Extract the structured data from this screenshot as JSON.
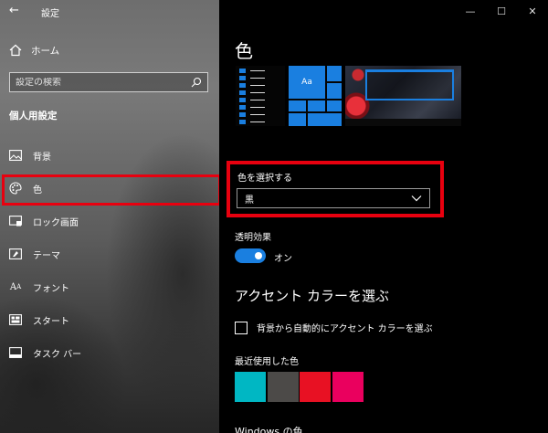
{
  "app": {
    "title": "設定"
  },
  "sidebar": {
    "home_label": "ホーム",
    "search_placeholder": "設定の検索",
    "section_title": "個人用設定",
    "items": [
      {
        "label": "背景",
        "icon": "image-icon"
      },
      {
        "label": "色",
        "icon": "palette-icon",
        "active": true
      },
      {
        "label": "ロック画面",
        "icon": "lock-screen-icon"
      },
      {
        "label": "テーマ",
        "icon": "theme-icon"
      },
      {
        "label": "フォント",
        "icon": "font-icon"
      },
      {
        "label": "スタート",
        "icon": "start-icon"
      },
      {
        "label": "タスク バー",
        "icon": "taskbar-icon"
      }
    ]
  },
  "main": {
    "title": "色",
    "preview": {
      "tile_text": "Aa"
    },
    "color_select": {
      "label": "色を選択する",
      "value": "黒"
    },
    "transparency": {
      "label": "透明効果",
      "state": "オン",
      "on": true
    },
    "accent": {
      "title": "アクセント カラーを選ぶ",
      "auto_checkbox_label": "背景から自動的にアクセント カラーを選ぶ",
      "auto_checked": false,
      "recent_label": "最近使用した色",
      "recent_colors": [
        "#00b7c3",
        "#4c4a48",
        "#e81123",
        "#ea005e"
      ],
      "windows_colors_label": "Windows の色"
    }
  },
  "colors": {
    "accent": "#1a7fe0",
    "highlight_box": "#e8000f"
  }
}
